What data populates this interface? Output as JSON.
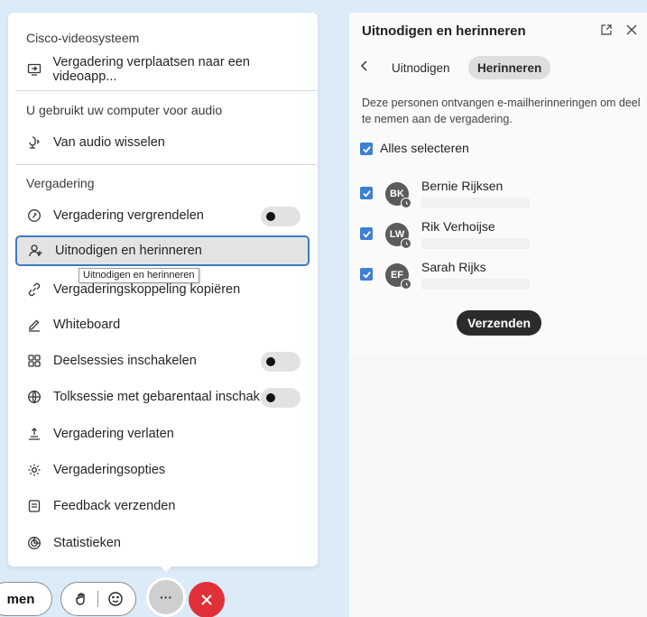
{
  "menu": {
    "sections": {
      "video_system": "Cisco-videosysteem",
      "audio": "U gebruikt uw computer voor audio",
      "meeting": "Vergadering"
    },
    "items": [
      {
        "label": "Vergadering verplaatsen naar een videoapp...",
        "icon": "screen-arrow-icon"
      },
      {
        "label": "Van audio wisselen",
        "icon": "audio-switch-icon"
      },
      {
        "label": "Vergadering vergrendelen",
        "icon": "lock-icon",
        "toggle": false
      },
      {
        "label": "Uitnodigen en herinneren",
        "icon": "person-add-icon",
        "active": true
      },
      {
        "label": "Vergaderingskoppeling kopiëren",
        "icon": "link-icon"
      },
      {
        "label": "Whiteboard",
        "icon": "pencil-icon"
      },
      {
        "label": "Deelsessies inschakelen",
        "icon": "grid-icon",
        "toggle": false
      },
      {
        "label": "Tolksessie met gebarentaal inschak...",
        "icon": "globe-icon",
        "toggle": false
      },
      {
        "label": "Vergadering verlaten",
        "icon": "leave-icon"
      },
      {
        "label": "Vergaderingsopties",
        "icon": "gear-icon"
      },
      {
        "label": "Feedback verzenden",
        "icon": "feedback-icon"
      },
      {
        "label": "Statistieken",
        "icon": "stats-icon"
      }
    ],
    "tooltip": "Uitnodigen en herinneren"
  },
  "controls": {
    "partial_label": "men",
    "more_label": "···"
  },
  "panel": {
    "title": "Uitnodigen en herinneren",
    "tabs": [
      "Uitnodigen",
      "Herinneren"
    ],
    "active_tab": "Herinneren",
    "description": "Deze personen ontvangen e-mailherinneringen om deel te nemen aan de vergadering.",
    "select_all": "Alles selecteren",
    "people": [
      {
        "initials": "BK",
        "name": "Bernie Rijksen",
        "checked": true
      },
      {
        "initials": "LW",
        "name": "Rik Verhoijse",
        "checked": true
      },
      {
        "initials": "EF",
        "name": "Sarah Rijks",
        "checked": true
      }
    ],
    "send_button": "Verzenden"
  },
  "colors": {
    "background": "#dcebf8",
    "accent": "#3d7fd3",
    "active_border": "#3f78c6",
    "end_call": "#e0313a"
  }
}
